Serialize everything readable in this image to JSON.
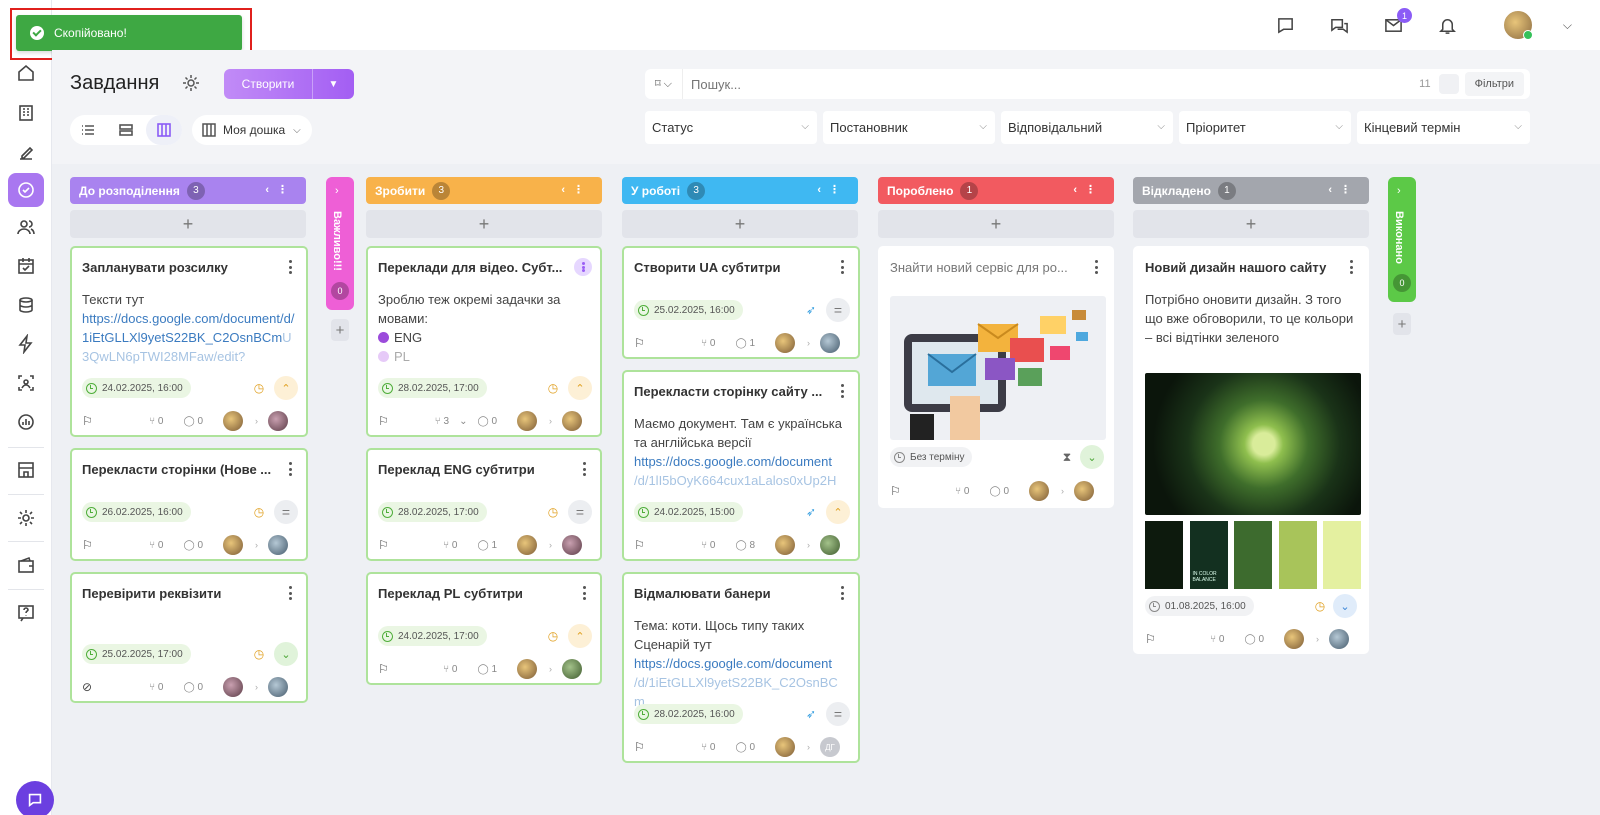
{
  "toast": {
    "text": "Скопійовано!"
  },
  "header": {
    "title": "Завдання",
    "create_label": "Створити",
    "board_label": "Моя дошка",
    "search_placeholder": "Пошук...",
    "search_count": "11",
    "filters_label": "Фільтри",
    "filters": [
      "Статус",
      "Постановник",
      "Відповідальний",
      "Пріоритет",
      "Кінцевий термін"
    ]
  },
  "topbar": {
    "mail_badge": "1"
  },
  "columns": [
    {
      "name": "До розподілення",
      "count": "3",
      "color": "#a983ef"
    },
    {
      "name": "Важливо!!!",
      "count": "0",
      "color": "#ee5fd6",
      "collapsed": true
    },
    {
      "name": "Зробити",
      "count": "3",
      "color": "#f8b24a"
    },
    {
      "name": "У роботі",
      "count": "3",
      "color": "#3fb8f2"
    },
    {
      "name": "Пороблено",
      "count": "1",
      "color": "#f25a60"
    },
    {
      "name": "Відкладено",
      "count": "1",
      "color": "#a3a6ad"
    },
    {
      "name": "Виконано",
      "count": "0",
      "color": "#5cc947",
      "collapsed": true
    }
  ],
  "cards": {
    "c1": {
      "title": "Запланувати розсилку",
      "text": "Тексти тут",
      "link": "https://docs.google.com/document/d/1iEtGLLXl9yetS22BK_C2OsnBCm",
      "link_fade": "U3QwLN6pTWI28MFaw/edit?",
      "date": "24.02.2025, 16:00",
      "subtasks": "0",
      "comments": "0"
    },
    "c2": {
      "title": "Перекласти сторінки (Нове ...",
      "date": "26.02.2025, 16:00",
      "subtasks": "0",
      "comments": "0"
    },
    "c3": {
      "title": "Перевірити реквізити",
      "date": "25.02.2025, 17:00",
      "subtasks": "0",
      "comments": "0"
    },
    "c4": {
      "title": "Переклади для відео. Субт...",
      "text": "Зроблю теж окремі задачки за мовами:",
      "item1": "ENG",
      "item2": "PL",
      "date": "28.02.2025, 17:00",
      "subtasks": "3",
      "comments": "0"
    },
    "c5": {
      "title": "Переклад ENG субтитри",
      "date": "28.02.2025, 17:00",
      "subtasks": "0",
      "comments": "1"
    },
    "c6": {
      "title": "Переклад PL субтитри",
      "date": "24.02.2025, 17:00",
      "subtasks": "0",
      "comments": "1"
    },
    "c7": {
      "title": "Створити UA субтитри",
      "date": "25.02.2025, 16:00",
      "subtasks": "0",
      "comments": "1"
    },
    "c8": {
      "title": "Перекласти сторінку сайту ...",
      "text": "Маємо документ. Там є українська та англійська версії",
      "link": "https://docs.google.com/document",
      "link_fade": "/d/1lI5bOyK664cux1aLalos0xUp2H",
      "date": "24.02.2025, 15:00",
      "subtasks": "0",
      "comments": "8"
    },
    "c9": {
      "title": "Відмалювати банери",
      "text": "Тема: коти. Щось типу таких Сценарій тут",
      "link": "https://docs.google.com/document",
      "link_fade": "/d/1iEtGLLXl9yetS22BK_C2OsnBCm",
      "date": "28.02.2025, 16:00",
      "subtasks": "0",
      "comments": "0",
      "assignee_initials": "ДГ"
    },
    "c10": {
      "title": "Знайти новий сервіс для ро...",
      "date": "Без терміну",
      "subtasks": "0",
      "comments": "0"
    },
    "c11": {
      "title": "Новий дизайн нашого сайту",
      "text": "Потрібно оновити дизайн. З того що вже обговорили, то це кольори – всі відтінки зеленого",
      "swatch_label": "IN COLOR BALANCE",
      "date": "01.08.2025, 16:00",
      "subtasks": "0",
      "comments": "0"
    }
  },
  "swatch_colors": [
    "#0d1a0d",
    "#133020",
    "#3d6b2e",
    "#a8c45a",
    "#e4f0a0"
  ]
}
